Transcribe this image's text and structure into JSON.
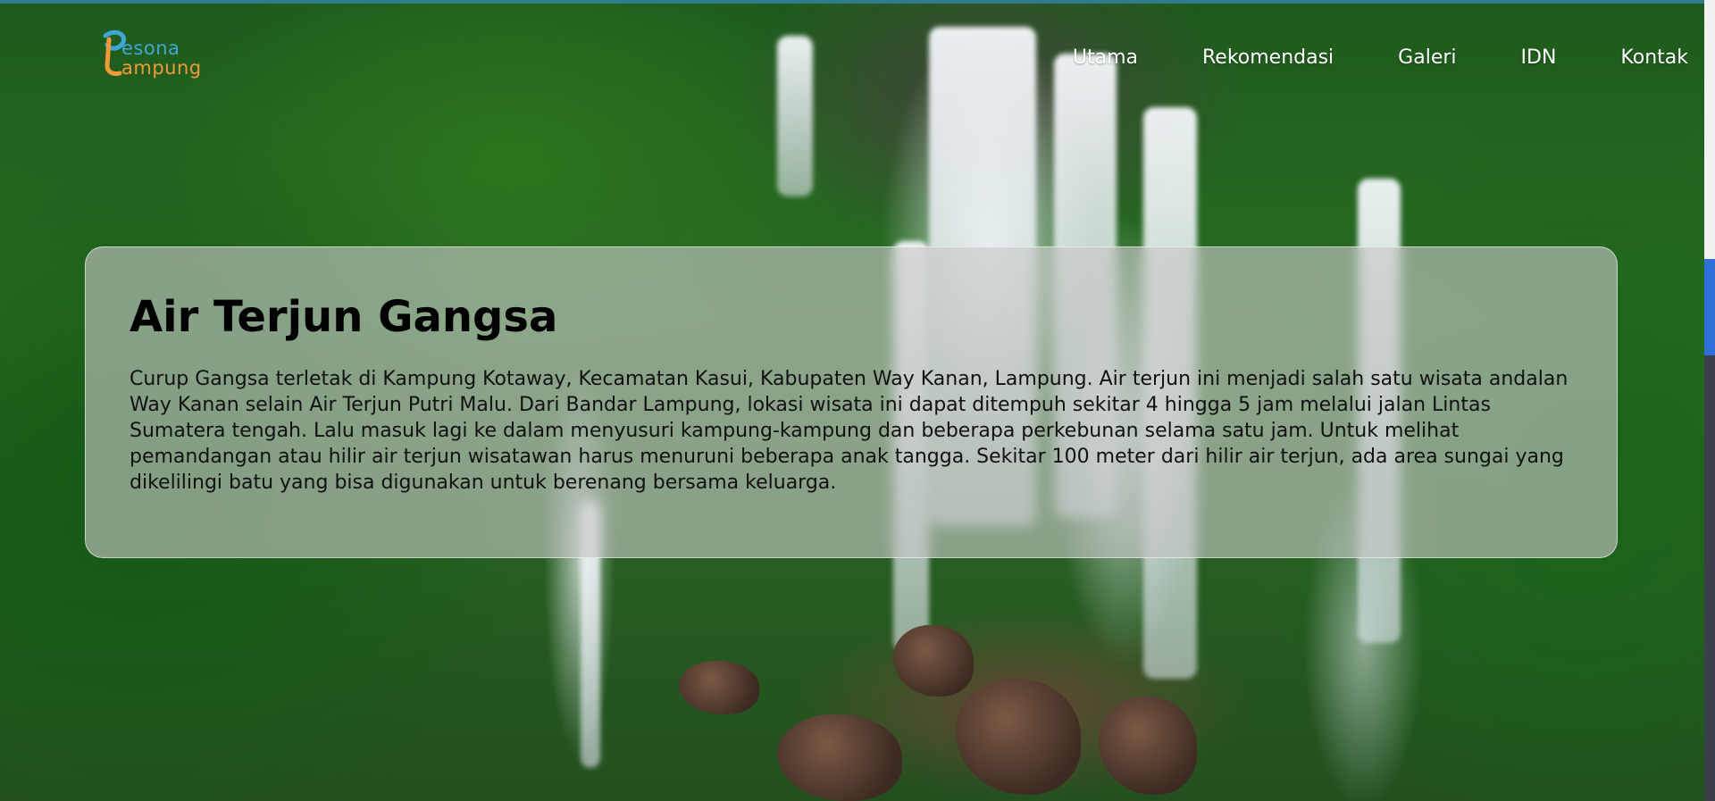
{
  "brand": {
    "logo_top": "esona",
    "logo_bottom": "ampung",
    "logo_initial_top": "P",
    "logo_initial_bottom": "L",
    "colors": {
      "top": "#3fa7d6",
      "bottom": "#f2993a"
    }
  },
  "nav": {
    "items": [
      {
        "label": "Utama"
      },
      {
        "label": "Rekomendasi"
      },
      {
        "label": "Galeri"
      },
      {
        "label": "IDN"
      },
      {
        "label": "Kontak"
      }
    ]
  },
  "hero": {
    "background_icon": "waterfall-photo",
    "title": "Air Terjun Gangsa",
    "description": "Curup Gangsa terletak di Kampung Kotaway, Kecamatan Kasui, Kabupaten Way Kanan, Lampung. Air terjun ini menjadi salah satu wisata andalan Way Kanan selain Air Terjun Putri Malu. Dari Bandar Lampung, lokasi wisata ini dapat ditempuh sekitar 4 hingga 5 jam melalui jalan Lintas Sumatera tengah. Lalu masuk lagi ke dalam menyusuri kampung-kampung dan beberapa perkebunan selama satu jam. Untuk melihat pemandangan atau hilir air terjun wisatawan harus menuruni beberapa anak tangga. Sekitar 100 meter dari hilir air terjun, ada area sungai yang dikelilingi batu yang bisa digunakan untuk berenang bersama keluarga."
  }
}
